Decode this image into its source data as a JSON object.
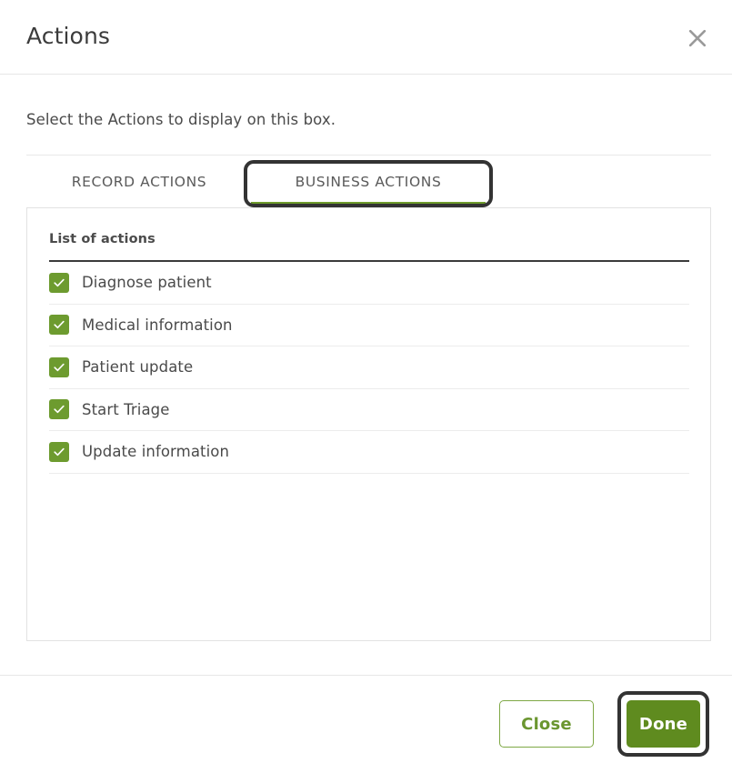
{
  "dialog": {
    "title": "Actions",
    "close_icon": "close-icon",
    "instruction": "Select the Actions to display on this box."
  },
  "tabs": [
    {
      "label": "RECORD ACTIONS",
      "selected": false
    },
    {
      "label": "BUSINESS ACTIONS",
      "selected": true
    }
  ],
  "list_panel": {
    "header": "List of actions",
    "rows": [
      {
        "label": "Diagnose patient",
        "checked": true
      },
      {
        "label": "Medical information",
        "checked": true
      },
      {
        "label": "Patient update",
        "checked": true
      },
      {
        "label": "Start Triage",
        "checked": true
      },
      {
        "label": "Update information",
        "checked": true
      }
    ]
  },
  "footer": {
    "close_label": "Close",
    "done_label": "Done"
  },
  "colors": {
    "accent_green": "#6d9b2f",
    "done_green": "#5f8b1f",
    "close_border_green": "#7fa845",
    "close_text_green": "#6b9630",
    "focus_ring": "#333333",
    "tab_underline": "#6f9c2c",
    "text": "#4a4a4a",
    "divider": "#e6e6e6"
  }
}
